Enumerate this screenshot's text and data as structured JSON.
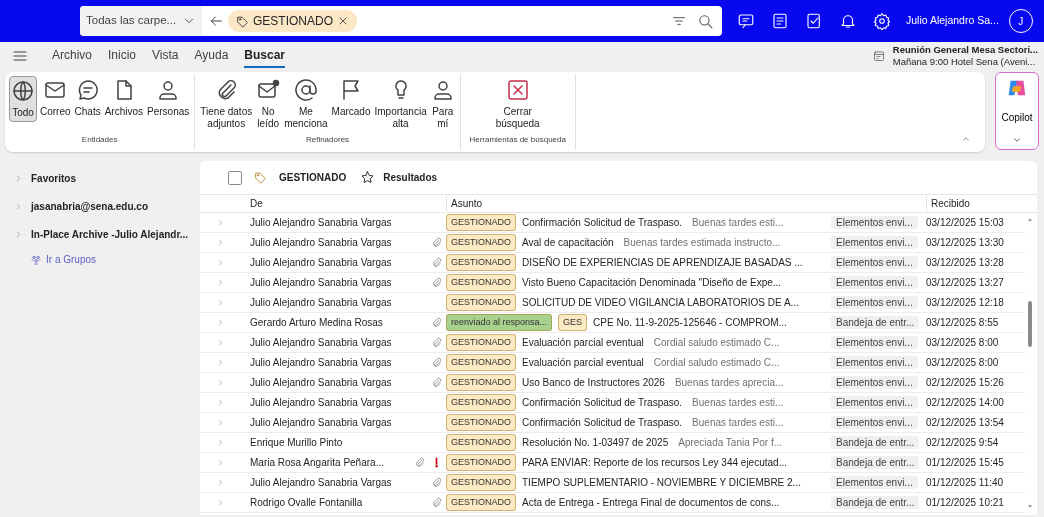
{
  "topbar": {
    "folder_scope": "Todas las carpe...",
    "search_chip": "GESTIONADO",
    "user_name": "Julio Alejandro Sa...",
    "avatar_initial": "J"
  },
  "menu_tabs": [
    {
      "label": "Archivo",
      "selected": false
    },
    {
      "label": "Inicio",
      "selected": false
    },
    {
      "label": "Vista",
      "selected": false
    },
    {
      "label": "Ayuda",
      "selected": false
    },
    {
      "label": "Buscar",
      "selected": true
    }
  ],
  "reminder": {
    "title": "Reunión General Mesa Sectori...",
    "detail": "Mañana 9:00 Hotel Sena (Aveni..."
  },
  "ribbon_groups": [
    {
      "label": "Entidades",
      "buttons": [
        {
          "label": "Todo",
          "selected": true
        },
        {
          "label": "Correo",
          "selected": false
        },
        {
          "label": "Chats",
          "selected": false
        },
        {
          "label": "Archivos",
          "selected": false
        },
        {
          "label": "Personas",
          "selected": false
        }
      ]
    },
    {
      "label": "Refinadores",
      "buttons": [
        {
          "label": "Tiene datos\nadjuntos",
          "selected": false
        },
        {
          "label": "No\nleído",
          "selected": false
        },
        {
          "label": "Me\nmenciona",
          "selected": false
        },
        {
          "label": "Marcado",
          "selected": false
        },
        {
          "label": "Importancia\nalta",
          "selected": false
        },
        {
          "label": "Para\nmí",
          "selected": false
        }
      ]
    },
    {
      "label": "Herramientas de búsqueda",
      "buttons": [
        {
          "label": "Cerrar\nbúsqueda",
          "selected": false
        }
      ]
    }
  ],
  "copilot": {
    "label": "Copilot"
  },
  "sidebar": {
    "items": [
      {
        "label": "Favoritos",
        "expanded": false
      },
      {
        "label": "jasanabria@sena.edu.co",
        "expanded": false
      },
      {
        "label": "In-Place Archive -Julio Alejandr...",
        "expanded": false
      }
    ],
    "link": "Ir a Grupos"
  },
  "list": {
    "filter_label": "GESTIONADO",
    "results_label": "Resultados",
    "select_all_checked": false,
    "columns": [
      "De",
      "Asunto",
      "Recibido"
    ],
    "rows": [
      {
        "from": "Julio Alejandro Sanabria Vargas",
        "attachment": false,
        "important": false,
        "categories": [
          {
            "label": "GESTIONADO",
            "color": "#fde9c2"
          }
        ],
        "subject": "Confirmación Solicitud de Traspaso.",
        "preview": "Buenas tardes esti...",
        "folder": "Elementos envi...",
        "received": "03/12/2025 15:03"
      },
      {
        "from": "Julio Alejandro Sanabria Vargas",
        "attachment": true,
        "important": false,
        "categories": [
          {
            "label": "GESTIONADO",
            "color": "#fde9c2"
          }
        ],
        "subject": "Aval de capacitación",
        "preview": "Buenas tardes estimada instructo...",
        "folder": "Elementos envi...",
        "received": "03/12/2025 13:30"
      },
      {
        "from": "Julio Alejandro Sanabria Vargas",
        "attachment": true,
        "important": false,
        "categories": [
          {
            "label": "GESTIONADO",
            "color": "#fde9c2"
          }
        ],
        "subject": "DISEÑO DE EXPERIENCIAS DE APRENDIZAJE BASADAS ...",
        "folder": "Elementos envi...",
        "received": "03/12/2025 13:28"
      },
      {
        "from": "Julio Alejandro Sanabria Vargas",
        "attachment": true,
        "important": false,
        "categories": [
          {
            "label": "GESTIONADO",
            "color": "#fde9c2"
          }
        ],
        "subject": "Visto Bueno Capacitación Denominada \"Diseño de Expe...",
        "folder": "Elementos envi...",
        "received": "03/12/2025 13:27"
      },
      {
        "from": "Julio Alejandro Sanabria Vargas",
        "attachment": false,
        "important": false,
        "categories": [
          {
            "label": "GESTIONADO",
            "color": "#fde9c2"
          }
        ],
        "subject": "SOLICITUD DE VIDEO VIGILANCIA LABORATORIOS DE A...",
        "folder": "Elementos envi...",
        "received": "03/12/2025 12:18"
      },
      {
        "from": "Gerardo Arturo Medina Rosas",
        "attachment": true,
        "important": false,
        "categories": [
          {
            "label": "reenviado al responsa...",
            "color": "#a9d18e"
          },
          {
            "label": "GES",
            "color": "#fde9c2"
          }
        ],
        "subject": "CPE No. 11-9-2025-125646 - COMPROM...",
        "folder": "Bandeja de entr...",
        "received": "03/12/2025 8:55"
      },
      {
        "from": "Julio Alejandro Sanabria Vargas",
        "attachment": true,
        "important": false,
        "categories": [
          {
            "label": "GESTIONADO",
            "color": "#fde9c2"
          }
        ],
        "subject": "Evaluación parcial eventual",
        "preview": "Cordial saludo estimado C...",
        "folder": "Elementos envi...",
        "received": "03/12/2025 8:00"
      },
      {
        "from": "Julio Alejandro Sanabria Vargas",
        "attachment": true,
        "important": false,
        "categories": [
          {
            "label": "GESTIONADO",
            "color": "#fde9c2"
          }
        ],
        "subject": "Evaluación parcial eventual",
        "preview": "Cordial saludo estimado C...",
        "folder": "Elementos envi...",
        "received": "03/12/2025 8:00"
      },
      {
        "from": "Julio Alejandro Sanabria Vargas",
        "attachment": true,
        "important": false,
        "categories": [
          {
            "label": "GESTIONADO",
            "color": "#fde9c2"
          }
        ],
        "subject": "Uso Banco de Instructores 2026",
        "preview": "Buenas tardes aprecia...",
        "folder": "Elementos envi...",
        "received": "02/12/2025 15:26"
      },
      {
        "from": "Julio Alejandro Sanabria Vargas",
        "attachment": false,
        "important": false,
        "categories": [
          {
            "label": "GESTIONADO",
            "color": "#fde9c2"
          }
        ],
        "subject": "Confirmación Solicitud de Traspaso.",
        "preview": "Buenas tardes esti...",
        "folder": "Elementos envi...",
        "received": "02/12/2025 14:00"
      },
      {
        "from": "Julio Alejandro Sanabria Vargas",
        "attachment": false,
        "important": false,
        "categories": [
          {
            "label": "GESTIONADO",
            "color": "#fde9c2"
          }
        ],
        "subject": "Confirmación Solicitud de Traspaso.",
        "preview": "Buenas tardes esti...",
        "folder": "Elementos envi...",
        "received": "02/12/2025 13:54"
      },
      {
        "from": "Enrique Murillo Pinto",
        "attachment": false,
        "important": false,
        "categories": [
          {
            "label": "GESTIONADO",
            "color": "#fde9c2"
          }
        ],
        "subject": "Resolución No. 1-03497 de 2025",
        "preview": "Apreciada Tania Por f...",
        "folder": "Bandeja de entr...",
        "received": "02/12/2025 9:54"
      },
      {
        "from": "Maria Rosa Angarita Peñara...",
        "attachment": true,
        "important": true,
        "categories": [
          {
            "label": "GESTIONADO",
            "color": "#fde9c2"
          }
        ],
        "subject": "PARA ENVIAR: Reporte de los recursos Ley 344 ejecutad...",
        "folder": "Bandeja de entr...",
        "received": "01/12/2025 15:45"
      },
      {
        "from": "Julio Alejandro Sanabria Vargas",
        "attachment": true,
        "important": false,
        "categories": [
          {
            "label": "GESTIONADO",
            "color": "#fde9c2"
          }
        ],
        "subject": "TIEMPO SUPLEMENTARIO - NOVIEMBRE Y DICIEMBRE 2...",
        "folder": "Elementos envi...",
        "received": "01/12/2025 11:40"
      },
      {
        "from": "Rodrigo Ovalle Fontanilla",
        "attachment": true,
        "important": false,
        "categories": [
          {
            "label": "GESTIONADO",
            "color": "#fde9c2"
          }
        ],
        "subject": "Acta de Entrega - Entrega Final de documentos de cons...",
        "folder": "Bandeja de entr...",
        "received": "01/12/2025 10:21"
      }
    ]
  }
}
